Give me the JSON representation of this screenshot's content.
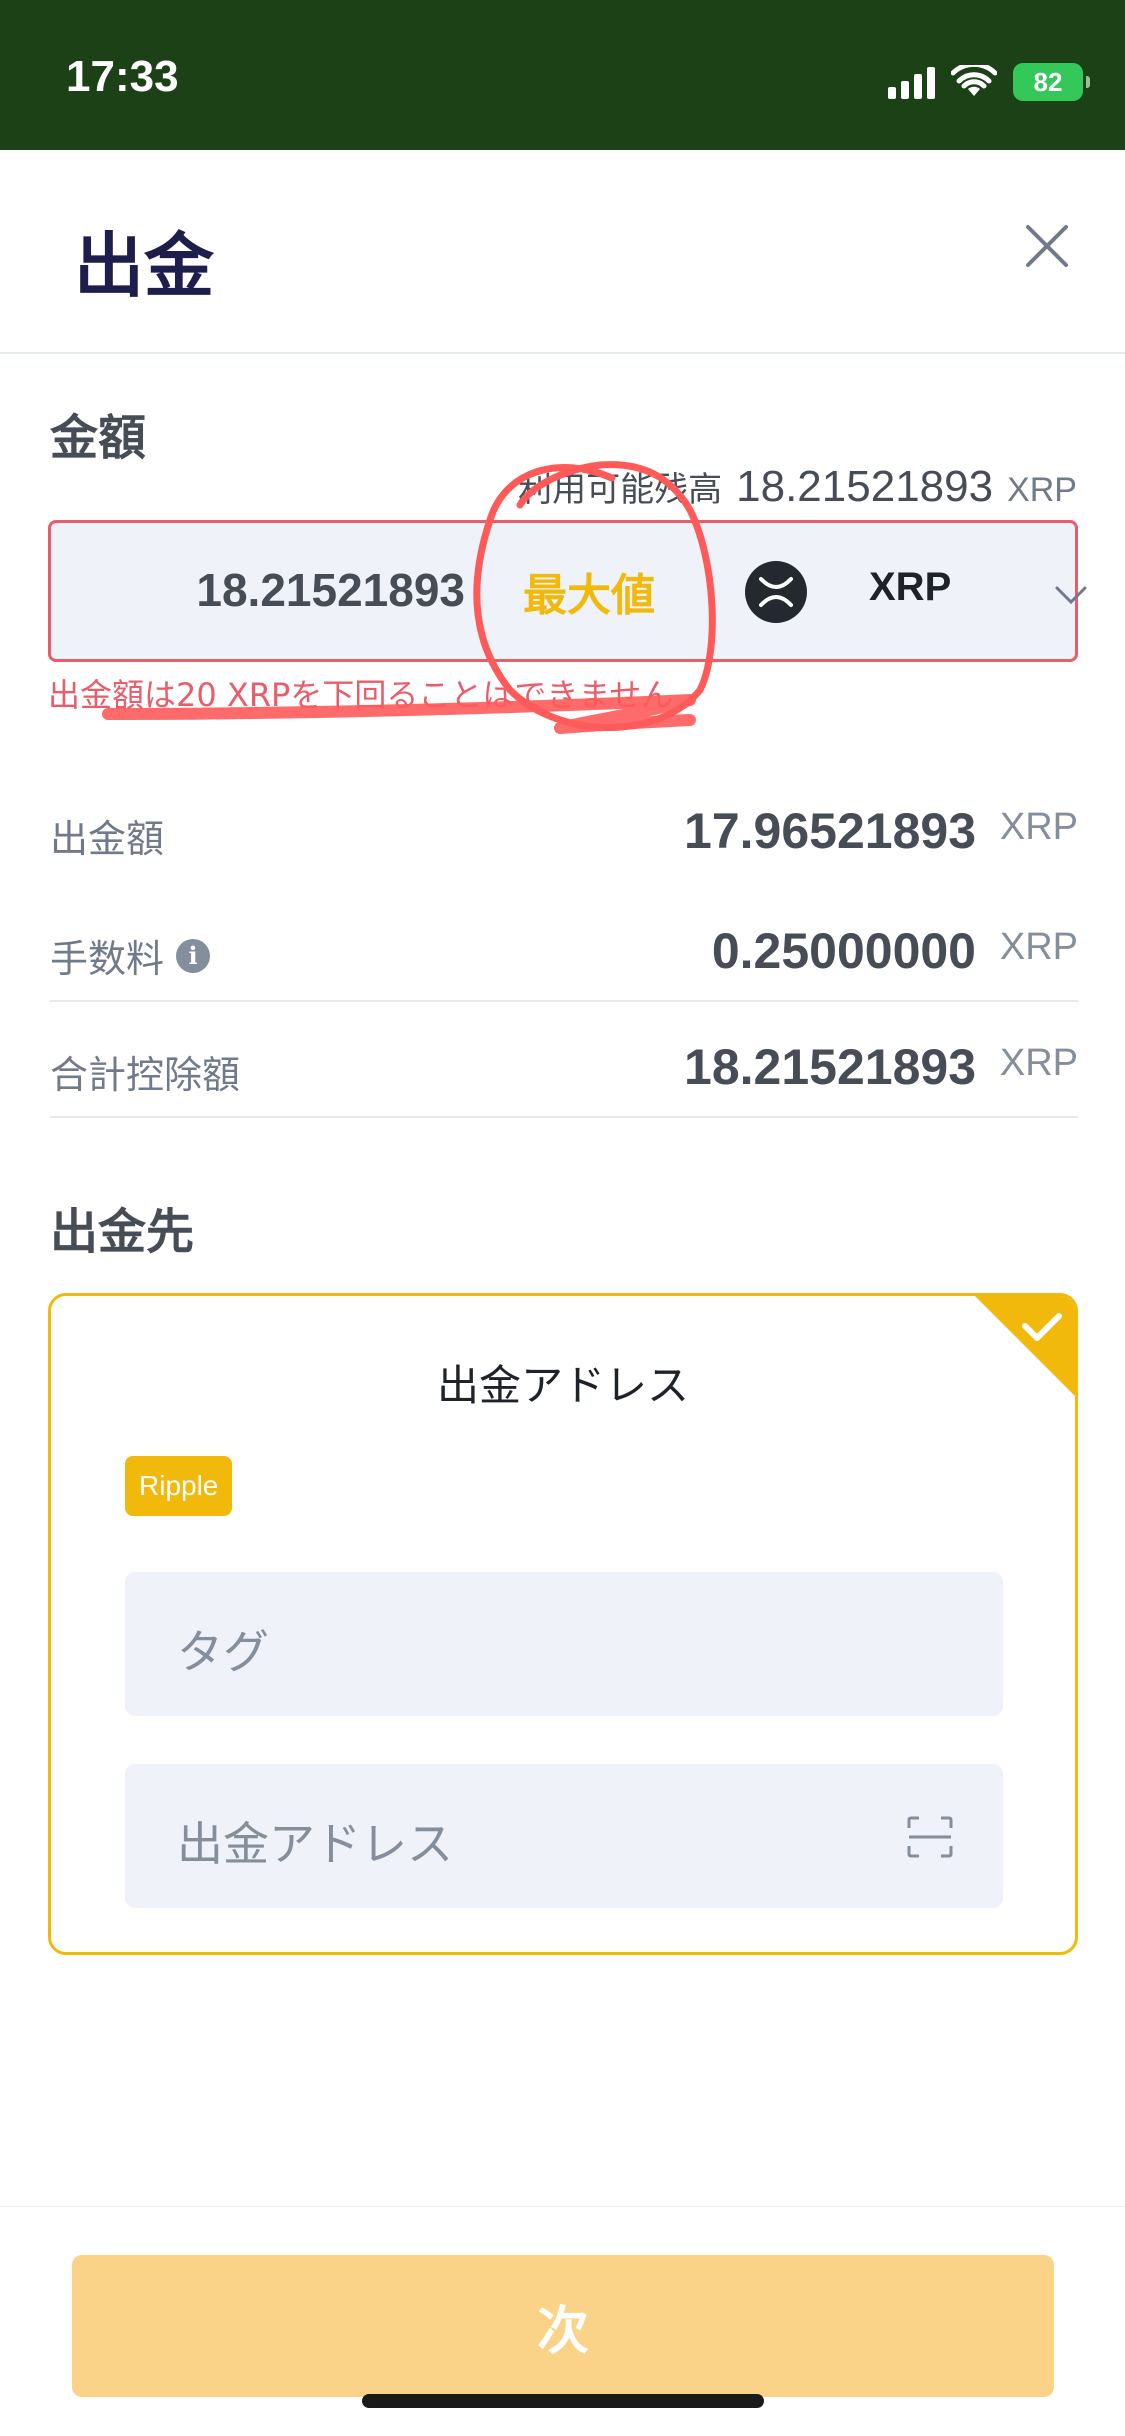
{
  "status_bar": {
    "time": "17:33",
    "battery": "82"
  },
  "header": {
    "title": "出金"
  },
  "amount": {
    "section_label": "金額",
    "available_label": "利用可能残高",
    "available_value": "18.21521893",
    "available_unit": "XRP",
    "input_value": "18.21521893",
    "max_label": "最大値",
    "coin": "XRP",
    "error": "出金額は20 XRPを下回ることはできません"
  },
  "summary": [
    {
      "label": "出金額",
      "value": "17.96521893",
      "unit": "XRP",
      "info": false
    },
    {
      "label": "手数料",
      "value": "0.25000000",
      "unit": "XRP",
      "info": true
    },
    {
      "label": "合計控除額",
      "value": "18.21521893",
      "unit": "XRP",
      "info": false
    }
  ],
  "destination": {
    "section_label": "出金先",
    "card_title": "出金アドレス",
    "network": "Ripple",
    "tag_placeholder": "タグ",
    "address_placeholder": "出金アドレス"
  },
  "footer": {
    "next_label": "次"
  },
  "colors": {
    "status_bar": "#1c4117",
    "accent": "#f0b90b",
    "error": "#e95d6a",
    "annotation": "#ff5a5a",
    "next_button": "#fbd388"
  },
  "icons": {
    "close": "close-icon",
    "coin": "xrp-icon",
    "dropdown": "chevron-down-icon",
    "info": "info-icon",
    "selected": "checkmark-icon",
    "scan": "scan-icon"
  }
}
